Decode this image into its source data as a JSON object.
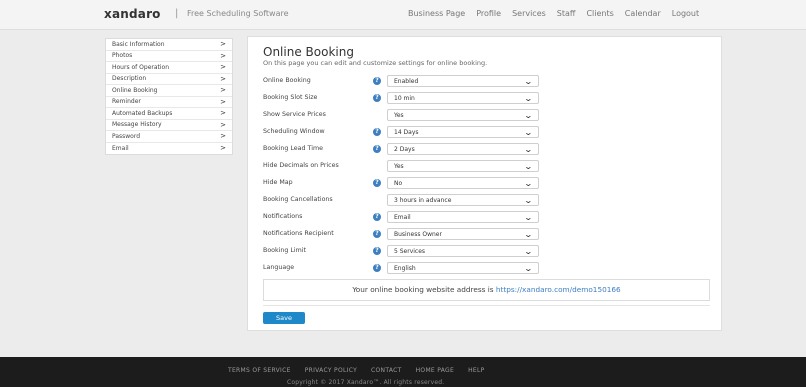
{
  "header": {
    "brand": "xandaro",
    "separator": "|",
    "tagline": "Free Scheduling Software",
    "nav": [
      "Business Page",
      "Profile",
      "Services",
      "Staff",
      "Clients",
      "Calendar",
      "Logout"
    ]
  },
  "sidebar": {
    "items": [
      {
        "label": "Basic Information",
        "chevron": ">"
      },
      {
        "label": "Photos",
        "chevron": ">"
      },
      {
        "label": "Hours of Operation",
        "chevron": ">"
      },
      {
        "label": "Description",
        "chevron": ">"
      },
      {
        "label": "Online Booking",
        "chevron": ">"
      },
      {
        "label": "Reminder",
        "chevron": ">"
      },
      {
        "label": "Automated Backups",
        "chevron": ">"
      },
      {
        "label": "Message History",
        "chevron": ">"
      },
      {
        "label": "Password",
        "chevron": ">"
      },
      {
        "label": "Email",
        "chevron": ">"
      }
    ]
  },
  "main": {
    "title": "Online Booking",
    "subtitle": "On this page you can edit and customize settings for online booking.",
    "help_glyph": "?",
    "caret_glyph": "⌄",
    "settings": [
      {
        "label": "Online Booking",
        "help": true,
        "value": "Enabled"
      },
      {
        "label": "Booking Slot Size",
        "help": true,
        "value": "10 min"
      },
      {
        "label": "Show Service Prices",
        "help": false,
        "value": "Yes"
      },
      {
        "label": "Scheduling Window",
        "help": true,
        "value": "14 Days"
      },
      {
        "label": "Booking Lead Time",
        "help": true,
        "value": "2 Days"
      },
      {
        "label": "Hide Decimals on Prices",
        "help": false,
        "value": "Yes"
      },
      {
        "label": "Hide Map",
        "help": true,
        "value": "No"
      },
      {
        "label": "Booking Cancellations",
        "help": false,
        "value": "3 hours in advance"
      },
      {
        "label": "Notifications",
        "help": true,
        "value": "Email"
      },
      {
        "label": "Notifications Recipient",
        "help": true,
        "value": "Business Owner"
      },
      {
        "label": "Booking Limit",
        "help": true,
        "value": "5 Services"
      },
      {
        "label": "Language",
        "help": true,
        "value": "English"
      }
    ],
    "url_prefix": "Your online booking website address is ",
    "url": "https://xandaro.com/demo150166",
    "save_label": "Save"
  },
  "footer": {
    "links": [
      "TERMS OF SERVICE",
      "PRIVACY POLICY",
      "CONTACT",
      "HOME PAGE",
      "HELP"
    ],
    "copyright": "Copyright © 2017 Xandaro™. All rights reserved."
  },
  "colors": {
    "accent": "#1e88c8",
    "help_icon": "#3d7fc1",
    "footer_bg": "#1c1c1c"
  }
}
